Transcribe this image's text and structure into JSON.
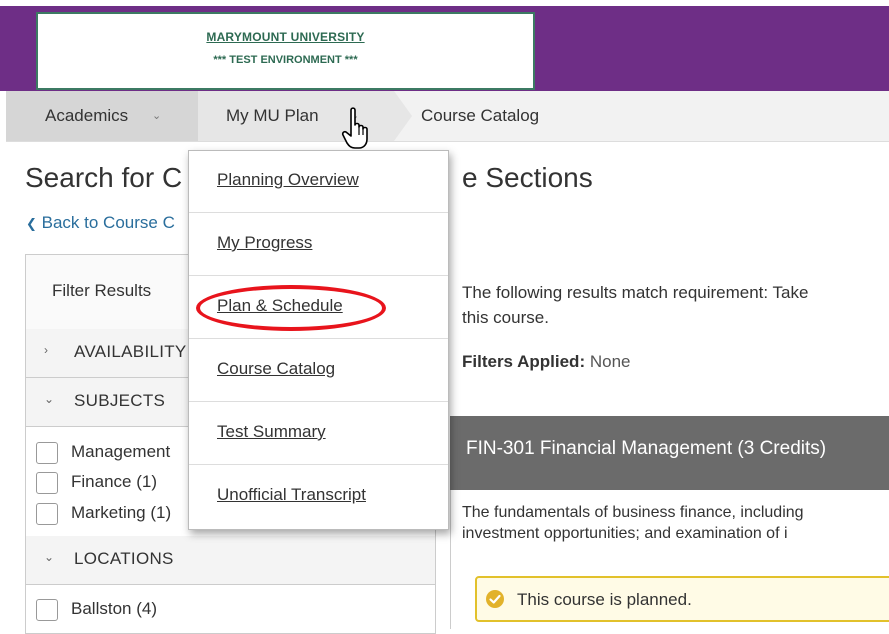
{
  "header": {
    "university": "MARYMOUNT UNIVERSITY",
    "environment": "*** TEST ENVIRONMENT ***"
  },
  "nav": {
    "items": [
      {
        "label": "Academics",
        "icon": "chevron-down-icon"
      },
      {
        "label": "My MU Plan",
        "icon": "chevron-down-icon"
      },
      {
        "label": "Course Catalog"
      }
    ]
  },
  "page": {
    "title": "Search for C",
    "title_end": "e Sections",
    "back_link": "Back to Course C"
  },
  "dropdown": {
    "items": [
      "Planning Overview",
      "My Progress",
      "Plan & Schedule",
      "Course Catalog",
      "Test Summary",
      "Unofficial Transcript"
    ]
  },
  "filters": {
    "title": "Filter Results",
    "sections": {
      "availability": "AVAILABILITY",
      "subjects": "SUBJECTS",
      "locations": "LOCATIONS"
    },
    "subjects": [
      "Management",
      "Finance (1)",
      "Marketing (1)"
    ],
    "locations": [
      "Ballston (4)"
    ]
  },
  "results": {
    "match_text_1": "The following results match requirement: Take",
    "match_text_2": "this course.",
    "filters_applied_label": "Filters Applied:",
    "filters_applied_value": "None"
  },
  "course": {
    "title": "FIN-301 Financial Management (3 Credits)",
    "desc_line1": "The fundamentals of business finance, including",
    "desc_line2": "investment opportunities; and examination of i",
    "status": "This course is planned."
  },
  "colors": {
    "header_purple": "#6e2e86",
    "highlight_red": "#e8141c",
    "planned_yellow": "#e2c12b"
  }
}
